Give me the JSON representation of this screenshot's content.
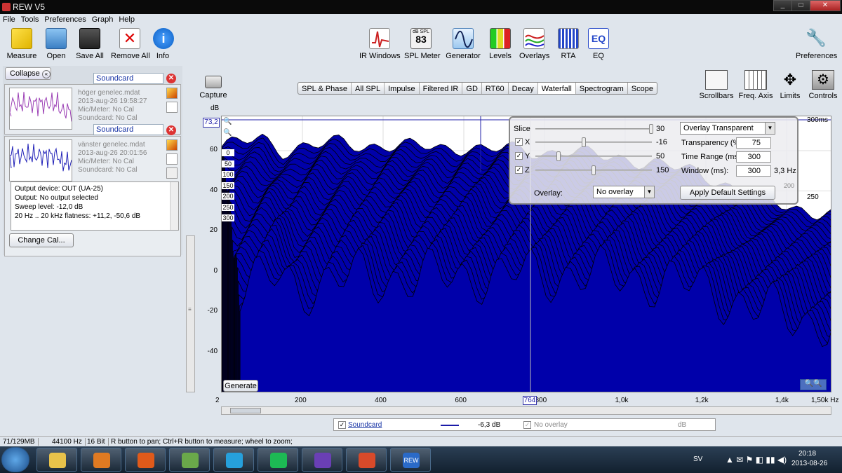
{
  "window": {
    "title": "REW V5",
    "min": "_",
    "max": "□",
    "close": "✕"
  },
  "menu": [
    "File",
    "Tools",
    "Preferences",
    "Graph",
    "Help"
  ],
  "toolbar_left": [
    {
      "label": "Measure",
      "icon": "measure-icon"
    },
    {
      "label": "Open",
      "icon": "folder-icon"
    },
    {
      "label": "Save All",
      "icon": "save-icon"
    },
    {
      "label": "Remove All",
      "icon": "remove-all-icon"
    },
    {
      "label": "Info",
      "icon": "info-icon"
    }
  ],
  "toolbar_center": [
    {
      "label": "IR Windows",
      "icon": "ir-windows-icon"
    },
    {
      "label": "SPL Meter",
      "icon": "spl-meter-icon",
      "meter_title": "dB SPL",
      "meter_value": "83"
    },
    {
      "label": "Generator",
      "icon": "generator-icon"
    },
    {
      "label": "Levels",
      "icon": "levels-icon"
    },
    {
      "label": "Overlays",
      "icon": "overlays-icon"
    },
    {
      "label": "RTA",
      "icon": "rta-icon"
    },
    {
      "label": "EQ",
      "icon": "eq-icon",
      "text": "EQ"
    }
  ],
  "preferences": {
    "label": "Preferences"
  },
  "left_panel": {
    "collapse": "Collapse",
    "measurements": [
      {
        "index": "1",
        "name": "Soundcard",
        "file": "höger genelec.mdat",
        "date": "2013-aug-26 19:58:27",
        "mic": "Mic/Meter: No Cal",
        "sc": "Soundcard: No Cal",
        "color": "#9b3fb5"
      },
      {
        "index": "2",
        "name": "Soundcard",
        "file": "vänster genelec.mdat",
        "date": "2013-aug-26 20:01:56",
        "mic": "Mic/Meter: No Cal",
        "sc": "Soundcard: No Cal",
        "color": "#2222b8"
      }
    ],
    "info_lines": [
      "Output device: OUT (UA-25)",
      "Output: No output selected",
      "Sweep level: -12,0 dB",
      "20 Hz .. 20 kHz flatness: +11,2, -50,6 dB"
    ],
    "change_cal": "Change Cal..."
  },
  "capture": {
    "label": "Capture"
  },
  "graph_tabs": [
    "SPL & Phase",
    "All SPL",
    "Impulse",
    "Filtered IR",
    "GD",
    "RT60",
    "Decay",
    "Waterfall",
    "Spectrogram",
    "Scope"
  ],
  "active_tab": "Waterfall",
  "right_controls": [
    {
      "label": "Scrollbars",
      "icon": "scrollbars-icon"
    },
    {
      "label": "Freq. Axis",
      "icon": "freq-axis-icon"
    },
    {
      "label": "Limits",
      "icon": "limits-icon"
    },
    {
      "label": "Controls",
      "icon": "controls-gear-icon"
    }
  ],
  "graph": {
    "y_unit": "dB",
    "y_cursor": "73,2",
    "y_ticks": [
      "60",
      "40",
      "20",
      "0",
      "-20",
      "-40"
    ],
    "x_ticks": [
      "2",
      "200",
      "400",
      "600",
      "800",
      "1,0k",
      "1,2k",
      "1,4k",
      "1,50k Hz"
    ],
    "x_cursor": "764",
    "time_labels": [
      "0",
      "50",
      "100",
      "150",
      "200",
      "250",
      "300"
    ],
    "time_top": "300ms",
    "time_right": "250",
    "time_right2": "200",
    "generate": "Generate",
    "fill_color": "#0000aa"
  },
  "chart_data": {
    "type": "area",
    "title": "",
    "xlabel": "Hz",
    "ylabel": "dB",
    "xlim": [
      2,
      1500
    ],
    "ylim": [
      -55,
      73.2
    ],
    "time_slices_ms": [
      0,
      50,
      100,
      150,
      200,
      250,
      300
    ],
    "x": [
      2,
      50,
      100,
      150,
      200,
      250,
      300,
      350,
      400,
      450,
      500,
      550,
      600,
      650,
      700,
      750,
      800,
      850,
      900,
      950,
      1000,
      1050,
      1100,
      1150,
      1200,
      1250,
      1300,
      1350,
      1400,
      1450,
      1500
    ],
    "series": [
      {
        "values": [
          62,
          64,
          66,
          60,
          62,
          63,
          64,
          62,
          63,
          62,
          62,
          61,
          62,
          60,
          61,
          60,
          59,
          60,
          58,
          57,
          56,
          54,
          52,
          50,
          47,
          42,
          38,
          35,
          32,
          30,
          28
        ]
      }
    ]
  },
  "overlay_panel": {
    "slice_label": "Slice",
    "slice_value": "30",
    "x_label": "X",
    "x_value": "-16",
    "y_label": "Y",
    "y_value": "50",
    "z_label": "Z",
    "z_value": "150",
    "mode": "Overlay Transparent",
    "transparency_label": "Transparency (%)",
    "transparency_value": "75",
    "time_range_label": "Time Range (ms):",
    "time_range_value": "300",
    "window_label": "Window (ms):",
    "window_value": "300",
    "window_hz": "3,3 Hz",
    "overlay_label": "Overlay:",
    "overlay_value": "No overlay",
    "apply": "Apply Default Settings"
  },
  "legend": {
    "name": "Soundcard",
    "value": "-6,3 dB",
    "overlay": "No overlay",
    "unit": "dB"
  },
  "status": {
    "mem": "71/129MB",
    "rate": "44100 Hz",
    "bits": "16 Bit",
    "hint": "R button to pan; Ctrl+R button to measure; wheel to zoom;"
  },
  "taskbar": {
    "lang": "SV",
    "time": "20:18",
    "date": "2013-08-26",
    "apps": [
      "explorer",
      "media-player",
      "firefox",
      "network",
      "skype",
      "spotify",
      "audio-app",
      "installer",
      "rew"
    ],
    "rew_label": "REW"
  }
}
